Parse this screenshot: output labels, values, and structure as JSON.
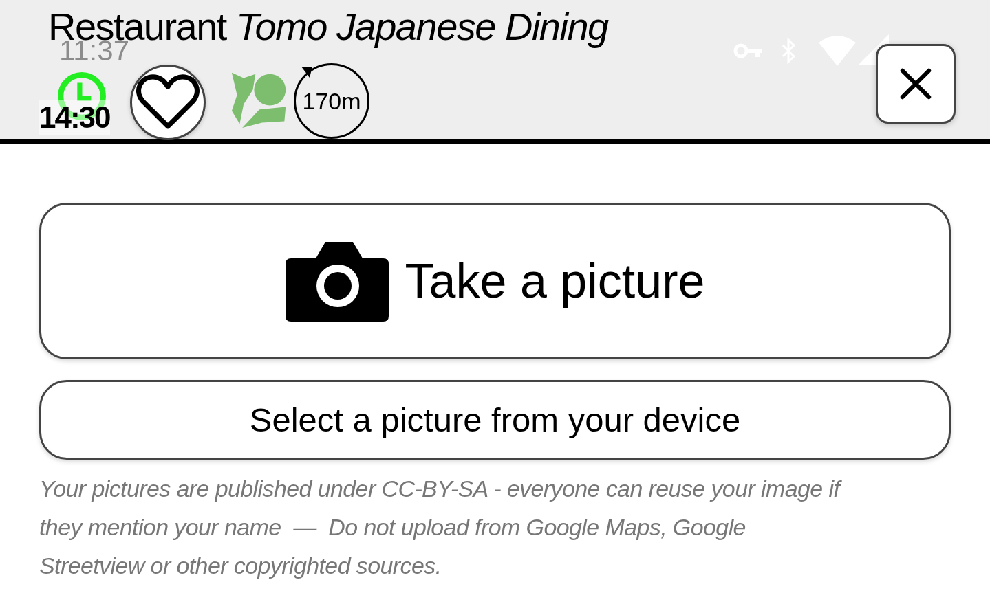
{
  "status_bar": {
    "time": "11:37"
  },
  "header": {
    "title": "Restaurant *Tomo Japanese Dining*",
    "opening_time": "14:30",
    "favorite": false,
    "distance": "170m"
  },
  "buttons": [
    {
      "kind": "camera",
      "label": "Take a picture"
    },
    {
      "kind": "plain",
      "label": "Select a picture from your device"
    }
  ],
  "note": "Your pictures are published under CC-BY-SA - everyone can reuse your image if they mention your name  —  Do not upload from Google Maps, Google Streetview or other copyrighted sources."
}
